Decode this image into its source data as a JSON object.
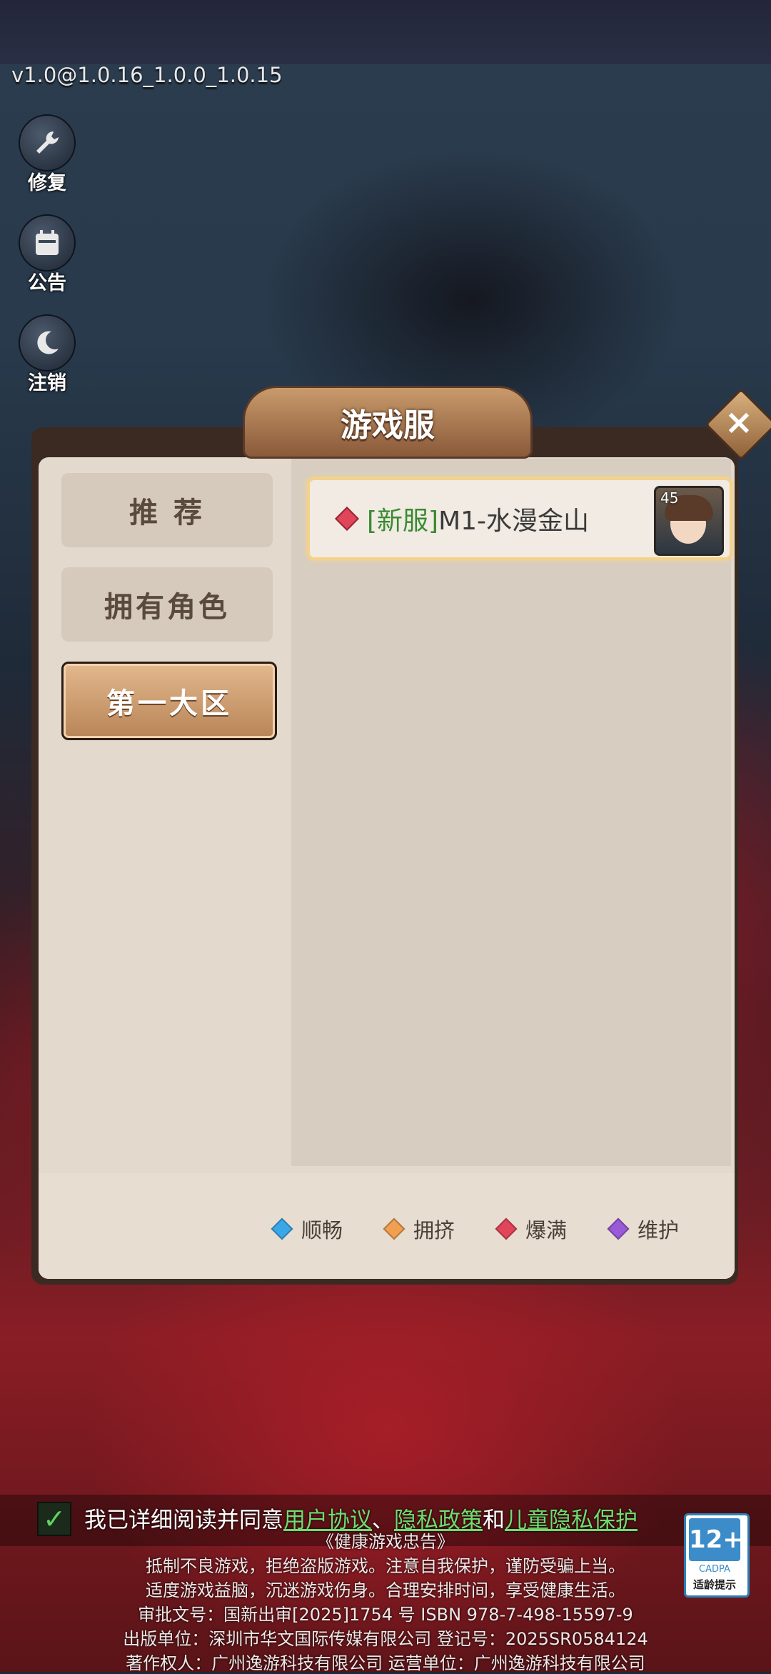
{
  "version": "v1.0@1.0.16_1.0.0_1.0.15",
  "side_buttons": [
    {
      "label": "修复",
      "icon": "wrench-icon"
    },
    {
      "label": "公告",
      "icon": "calendar-icon"
    },
    {
      "label": "注销",
      "icon": "moon-icon"
    }
  ],
  "dialog": {
    "title": "游戏服",
    "close_icon": "close-icon",
    "tabs": [
      {
        "label": "推 荐",
        "active": false
      },
      {
        "label": "拥有角色",
        "active": false
      },
      {
        "label": "第一大区",
        "active": true
      }
    ],
    "servers": [
      {
        "tag": "[新服]",
        "name": "M1-水漫金山",
        "status_color": "#e0455a",
        "avatar_level": "45"
      }
    ],
    "legend": [
      {
        "label": "顺畅",
        "color": "#3aa8e8"
      },
      {
        "label": "拥挤",
        "color": "#f0a050"
      },
      {
        "label": "爆满",
        "color": "#e0455a"
      },
      {
        "label": "维护",
        "color": "#9a5ad8"
      }
    ]
  },
  "agreement": {
    "prefix": "我已详细阅读并同意",
    "user_agreement": "用户协议",
    "sep1": "、",
    "privacy_policy": "隐私政策",
    "and": "和",
    "child_privacy": "儿童隐私保护"
  },
  "notice": {
    "title": "《健康游戏忠告》",
    "line1": "抵制不良游戏，拒绝盗版游戏。注意自我保护，谨防受骗上当。",
    "line2": "适度游戏益脑，沉迷游戏伤身。合理安排时间，享受健康生活。",
    "line3": "审批文号：国新出审[2025]1754 号 ISBN 978-7-498-15597-9",
    "line4": "出版单位：深圳市华文国际传媒有限公司 登记号：2025SR0584124",
    "line5": "著作权人：广州逸游科技有限公司 运营单位：广州逸游科技有限公司"
  },
  "cadpa": {
    "age": "12+",
    "org": "CADPA",
    "tip": "适龄提示"
  }
}
